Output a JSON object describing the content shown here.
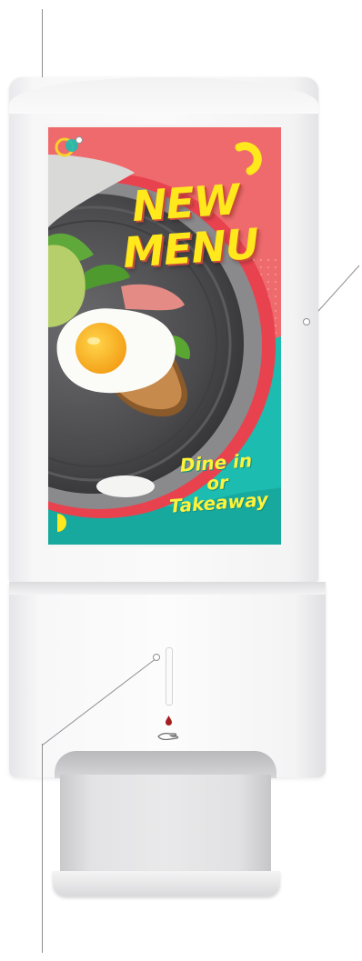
{
  "poster": {
    "headline_line1": "NEW",
    "headline_line2": "MENU",
    "tagline_line1": "Dine in",
    "tagline_line2": "or",
    "tagline_line3": "Takeaway"
  },
  "colors": {
    "poster_background": "#ef6a6c",
    "teal_wave": "#1dbcb0",
    "headline_yellow": "#ffe81c",
    "kiosk_white": "#f7f7f8",
    "tray_gray": "#e3e3e5"
  },
  "icons": [
    "sanitizer-drop-icon",
    "hand-icon",
    "brand-logo-icon"
  ]
}
